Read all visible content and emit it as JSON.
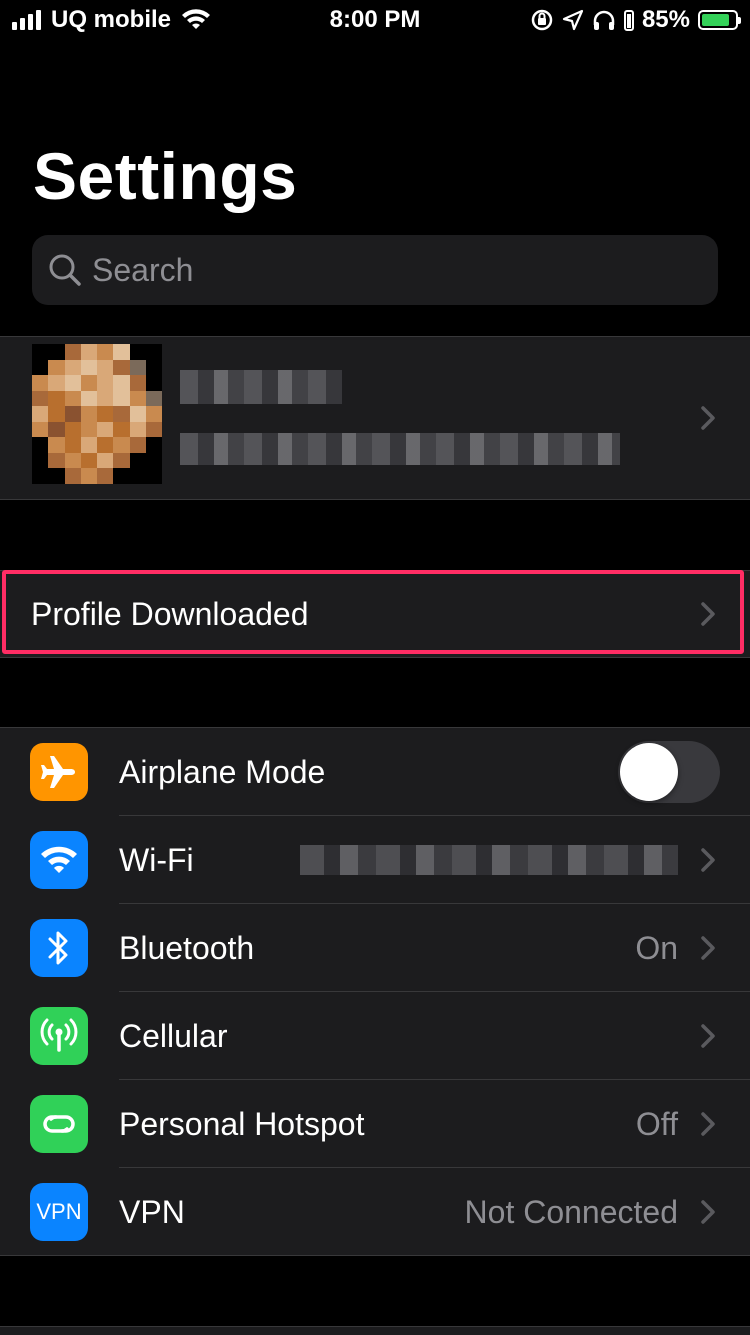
{
  "status_bar": {
    "carrier": "UQ mobile",
    "time": "8:00 PM",
    "battery_percent": "85%",
    "battery_level": 0.85
  },
  "page_title": "Settings",
  "search": {
    "placeholder": "Search"
  },
  "profile_banner": {
    "label": "Profile Downloaded"
  },
  "settings_rows": [
    {
      "label": "Airplane Mode",
      "icon": "airplane-icon",
      "icon_color": "#ff9500",
      "toggle_on": false
    },
    {
      "label": "Wi-Fi",
      "icon": "wifi-icon",
      "icon_color": "#0a84ff",
      "value": ""
    },
    {
      "label": "Bluetooth",
      "icon": "bluetooth-icon",
      "icon_color": "#0a84ff",
      "value": "On"
    },
    {
      "label": "Cellular",
      "icon": "cellular-antenna-icon",
      "icon_color": "#30d158",
      "value": ""
    },
    {
      "label": "Personal Hotspot",
      "icon": "hotspot-link-icon",
      "icon_color": "#30d158",
      "value": "Off"
    },
    {
      "label": "VPN",
      "icon": "vpn-icon",
      "icon_color": "#0a84ff",
      "icon_text": "VPN",
      "value": "Not Connected"
    }
  ],
  "colors": {
    "background": "#000000",
    "group_background": "#1c1c1e",
    "separator": "#38383a",
    "secondary_text": "#8e8e93",
    "highlight_outline": "#ff2d64"
  }
}
